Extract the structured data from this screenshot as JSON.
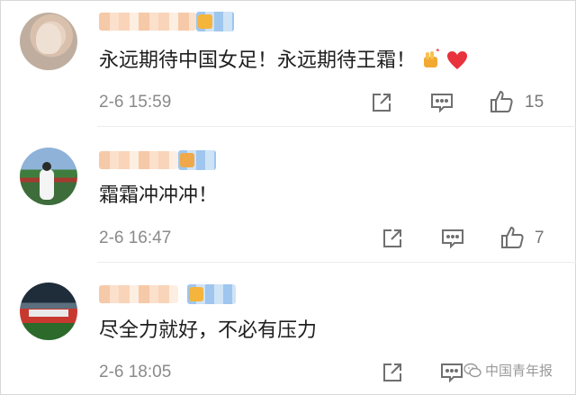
{
  "comments": [
    {
      "avatar": "user-avatar-portrait",
      "text": "永远期待中国女足！永远期待王霜！",
      "emojis": [
        "raised-fist-emoji",
        "red-heart-emoji"
      ],
      "time": "2-6 15:59",
      "likes": "15"
    },
    {
      "avatar": "user-avatar-football-player",
      "text": "霜霜冲冲冲！",
      "emojis": [],
      "time": "2-6 16:47",
      "likes": "7"
    },
    {
      "avatar": "user-avatar-team-photo",
      "text": "尽全力就好，不必有压力",
      "emojis": [],
      "time": "2-6 18:05",
      "likes": ""
    }
  ],
  "watermark": {
    "text": "中国青年报",
    "icon": "wechat-icon"
  },
  "actions": {
    "share_icon": "share-icon",
    "reply_icon": "comment-icon",
    "like_icon": "thumbs-up-icon"
  },
  "colors": {
    "text": "#1e1e1e",
    "meta": "#8a8a8a",
    "icon": "#6f6f6f",
    "heart": "#e8323c"
  }
}
